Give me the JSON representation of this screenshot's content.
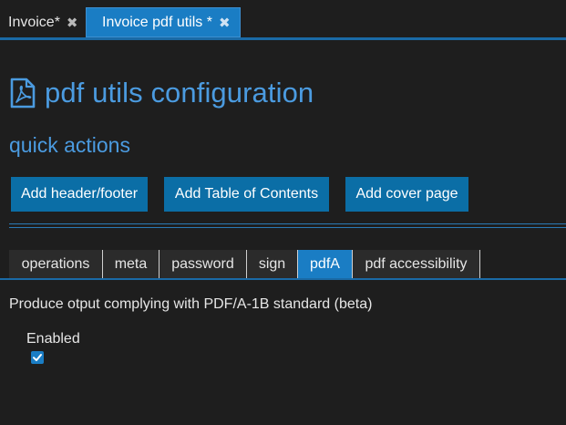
{
  "doc_tabs": [
    {
      "label": "Invoice*",
      "close_icon": "close-icon"
    },
    {
      "label": "Invoice pdf utils *",
      "close_icon": "close-icon",
      "active": true
    }
  ],
  "header": {
    "icon": "pdf-file-icon",
    "title": "pdf utils configuration"
  },
  "quick_actions": {
    "title": "quick actions",
    "buttons": [
      "Add header/footer",
      "Add Table of Contents",
      "Add cover page"
    ]
  },
  "settings_tabs": {
    "items": [
      "operations",
      "meta",
      "password",
      "sign",
      "pdfA",
      "pdf accessibility"
    ],
    "active": "pdfA"
  },
  "pdfa_panel": {
    "description": "Produce otput complying with PDF/A-1B standard (beta)",
    "enabled_label": "Enabled",
    "enabled": true
  },
  "colors": {
    "accent": "#1a7dc4",
    "button": "#0b6ea6",
    "heading": "#4b9be0",
    "background": "#1e1e1e"
  }
}
